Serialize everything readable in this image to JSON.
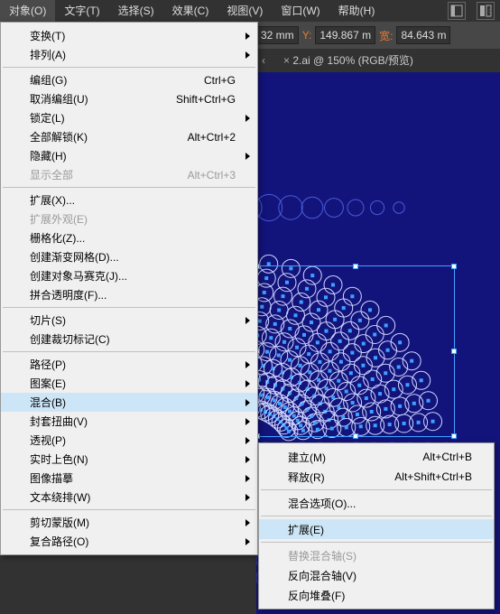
{
  "menubar": {
    "items": [
      "对象(O)",
      "文字(T)",
      "选择(S)",
      "效果(C)",
      "视图(V)",
      "窗口(W)",
      "帮助(H)"
    ],
    "active_index": 0
  },
  "toolbar": {
    "x_value": "32 mm",
    "y_label": "Y:",
    "y_value": "149.867 m",
    "w_label": "宽:",
    "w_value": "84.643 m"
  },
  "tab": {
    "title": "2.ai @ 150% (RGB/预览)",
    "close": "×"
  },
  "menu": {
    "items": [
      {
        "t": "变换(T)",
        "sub": true
      },
      {
        "t": "排列(A)",
        "sub": true
      },
      {
        "sep": true
      },
      {
        "t": "编组(G)",
        "sc": "Ctrl+G"
      },
      {
        "t": "取消编组(U)",
        "sc": "Shift+Ctrl+G"
      },
      {
        "t": "锁定(L)",
        "sub": true
      },
      {
        "t": "全部解锁(K)",
        "sc": "Alt+Ctrl+2"
      },
      {
        "t": "隐藏(H)",
        "sub": true
      },
      {
        "t": "显示全部",
        "sc": "Alt+Ctrl+3",
        "dis": true
      },
      {
        "sep": true
      },
      {
        "t": "扩展(X)..."
      },
      {
        "t": "扩展外观(E)",
        "dis": true
      },
      {
        "t": "栅格化(Z)..."
      },
      {
        "t": "创建渐变网格(D)..."
      },
      {
        "t": "创建对象马赛克(J)..."
      },
      {
        "t": "拼合透明度(F)..."
      },
      {
        "sep": true
      },
      {
        "t": "切片(S)",
        "sub": true
      },
      {
        "t": "创建裁切标记(C)"
      },
      {
        "sep": true
      },
      {
        "t": "路径(P)",
        "sub": true
      },
      {
        "t": "图案(E)",
        "sub": true
      },
      {
        "t": "混合(B)",
        "sub": true,
        "hov": true
      },
      {
        "t": "封套扭曲(V)",
        "sub": true
      },
      {
        "t": "透视(P)",
        "sub": true
      },
      {
        "t": "实时上色(N)",
        "sub": true
      },
      {
        "t": "图像描摹",
        "sub": true
      },
      {
        "t": "文本绕排(W)",
        "sub": true
      },
      {
        "sep": true
      },
      {
        "t": "剪切蒙版(M)",
        "sub": true
      },
      {
        "t": "复合路径(O)",
        "sub": true
      }
    ]
  },
  "submenu": {
    "items": [
      {
        "t": "建立(M)",
        "sc": "Alt+Ctrl+B"
      },
      {
        "t": "释放(R)",
        "sc": "Alt+Shift+Ctrl+B"
      },
      {
        "sep": true
      },
      {
        "t": "混合选项(O)..."
      },
      {
        "sep": true
      },
      {
        "t": "扩展(E)",
        "hov": true
      },
      {
        "sep": true
      },
      {
        "t": "替换混合轴(S)",
        "dis": true
      },
      {
        "t": "反向混合轴(V)"
      },
      {
        "t": "反向堆叠(F)"
      }
    ]
  }
}
